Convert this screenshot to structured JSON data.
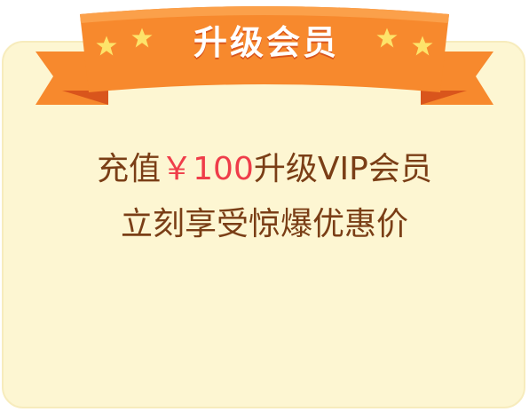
{
  "banner": {
    "title": "升级会员"
  },
  "offer": {
    "line1_prefix": "充值",
    "price": "￥100",
    "line1_suffix": "升级VIP会员",
    "line2": "立刻享受惊爆优惠价"
  },
  "colors": {
    "card_background": "#fdf6d2",
    "ribbon_orange": "#f7892d",
    "ribbon_dark": "#e86523",
    "star_yellow": "#fde36a",
    "text_brown": "#7a3e16",
    "price_red": "#ef3d4a"
  },
  "icons": [
    "star-icon",
    "star-icon",
    "star-icon",
    "star-icon"
  ]
}
